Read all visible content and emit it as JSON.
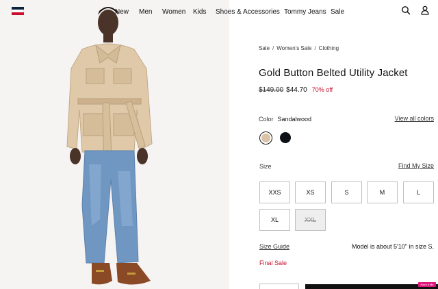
{
  "header": {
    "nav": [
      "New",
      "Men",
      "Women",
      "Kids",
      "Shoes & Accessories",
      "Tommy Jeans",
      "Sale"
    ],
    "logo_colors": [
      "#0c2340",
      "#ffffff",
      "#c8102e"
    ]
  },
  "breadcrumb": {
    "items": [
      "Sale",
      "Women's Sale",
      "Clothing"
    ],
    "separator": "/"
  },
  "product": {
    "title": "Gold Button Belted Utility Jacket",
    "price_original": "$149.00",
    "price_sale": "$44.70",
    "discount": "70% off"
  },
  "color": {
    "label": "Color",
    "value": "Sandalwood",
    "view_all": "View all colors",
    "swatches": [
      {
        "name": "sandalwood",
        "hex": "#dcc3a7",
        "selected": true
      },
      {
        "name": "black",
        "hex": "#0d1117",
        "selected": false
      }
    ]
  },
  "size": {
    "label": "Size",
    "find_my_size": "Find My Size",
    "options": [
      {
        "label": "XXS",
        "available": true
      },
      {
        "label": "XS",
        "available": true
      },
      {
        "label": "S",
        "available": true
      },
      {
        "label": "M",
        "available": true
      },
      {
        "label": "L",
        "available": true
      },
      {
        "label": "XL",
        "available": true
      },
      {
        "label": "XXL",
        "available": false
      }
    ]
  },
  "info": {
    "size_guide": "Size Guide",
    "model_info": "Model is about 5'10\" in size S.",
    "final_sale": "Final Sale"
  },
  "badge": {
    "text": "Point It Me"
  },
  "colors": {
    "accent_red": "#c8102e",
    "text": "#111111",
    "border": "#bfbfbf"
  }
}
